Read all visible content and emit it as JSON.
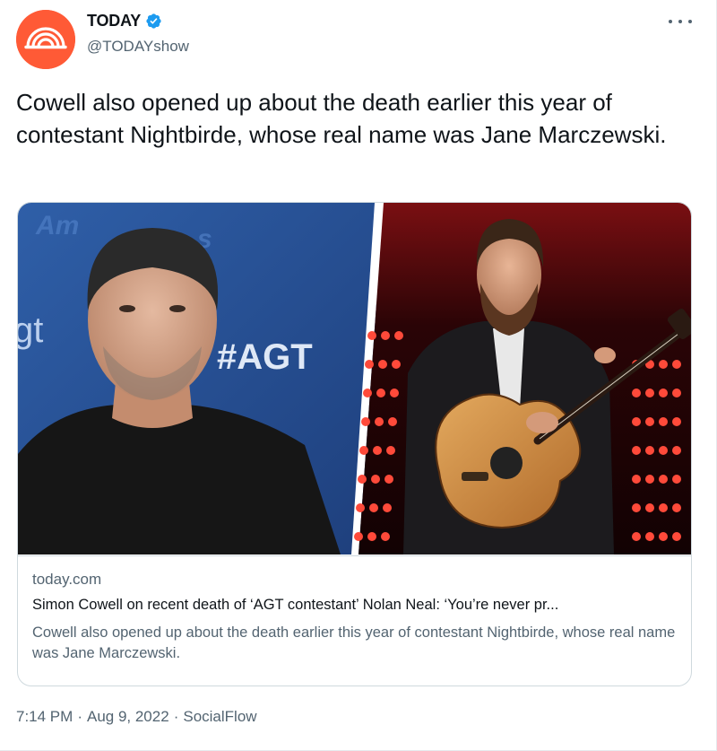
{
  "author": {
    "display_name": "TODAY",
    "handle": "@TODAYshow",
    "verified": true,
    "avatar_icon": "today-rainbow-logo-icon",
    "avatar_color": "#ff5a36"
  },
  "tweet": {
    "text": "Cowell also opened up about the death earlier this year of contestant Nightbirde, whose real name was Jane Marczewski."
  },
  "card": {
    "image_left_text": "#AGT",
    "image_left_text_2": "gt",
    "domain": "today.com",
    "title": "Simon Cowell on recent death of ‘AGT contestant’ Nolan Neal: ‘You’re never pr...",
    "description": "Cowell also opened up about the death earlier this year of contestant Nightbirde, whose real name was Jane Marczewski."
  },
  "meta": {
    "time": "7:14 PM",
    "date": "Aug 9, 2022",
    "source": "SocialFlow"
  },
  "icons": {
    "more": "more-options-icon",
    "verified": "verified-badge-icon"
  },
  "colors": {
    "text_primary": "#0f1419",
    "text_secondary": "#536471",
    "verified_blue": "#1d9bf0",
    "border": "#cfd9de"
  }
}
